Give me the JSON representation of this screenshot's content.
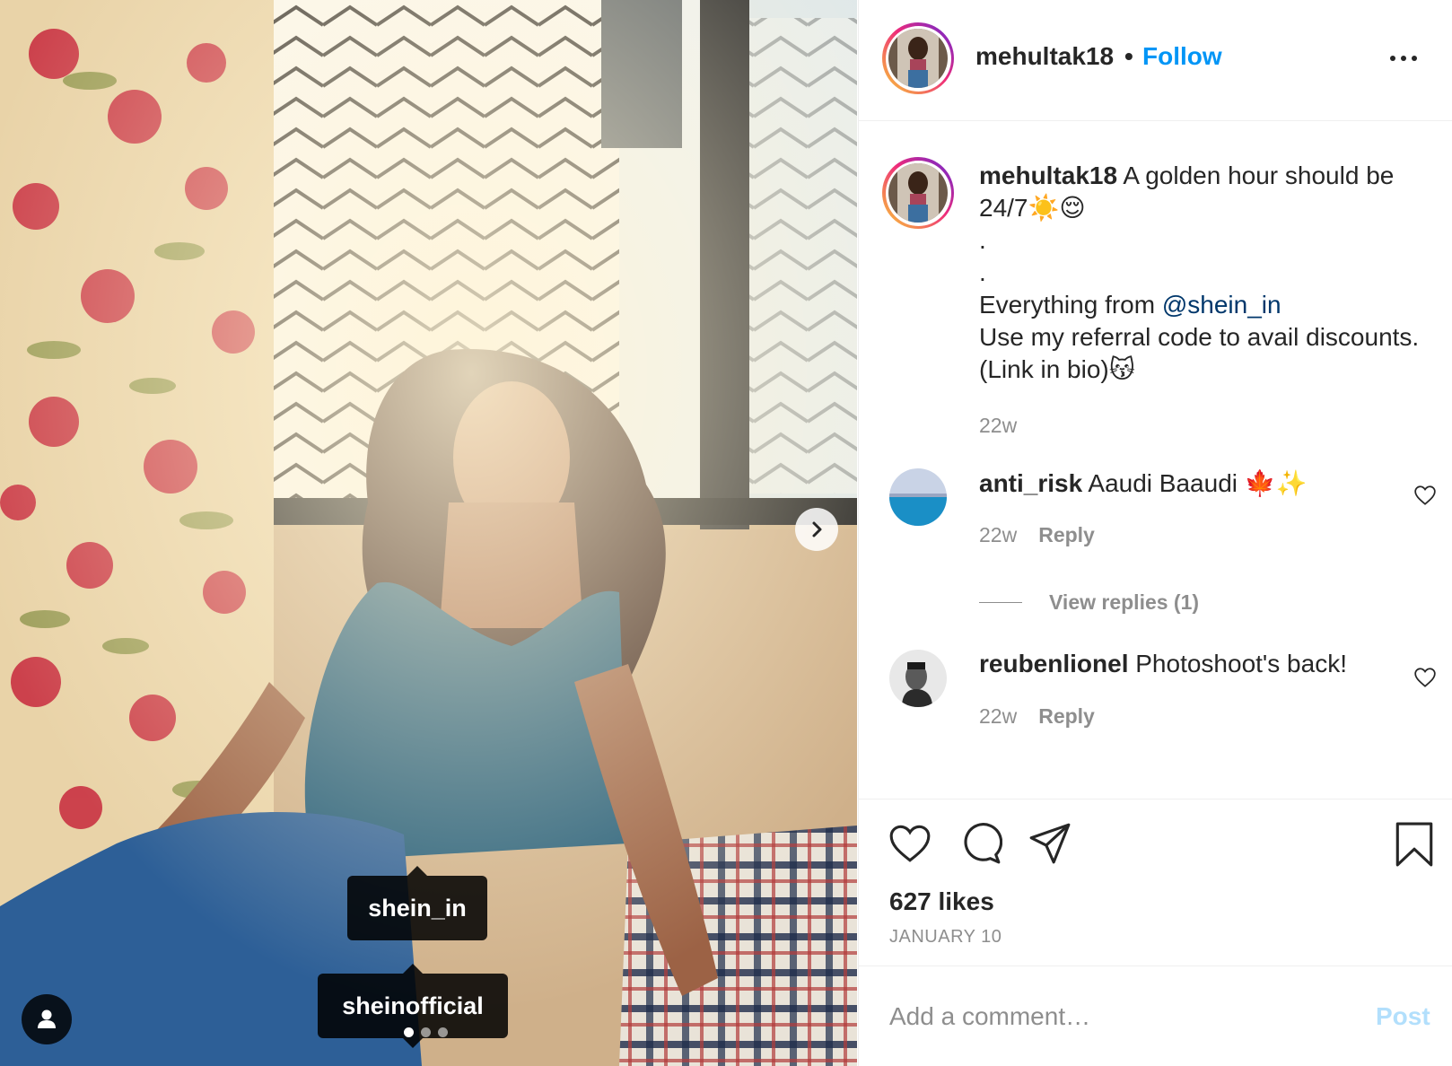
{
  "post": {
    "username": "mehultak18",
    "separator": "•",
    "follow_label": "Follow",
    "caption_lines": {
      "first": "A golden hour should be 24/7☀️😌",
      "dot1": ".",
      "dot2": ".",
      "everything_prefix": "Everything from ",
      "mention": "@shein_in",
      "referral": "Use my referral code to avail discounts.",
      "link": "(Link in bio)😽"
    },
    "caption_time": "22w"
  },
  "media": {
    "tags": [
      "shein_in",
      "sheinofficial"
    ],
    "carousel_count": 3,
    "carousel_active": 1
  },
  "comments": [
    {
      "username": "anti_risk",
      "text": "Aaudi Baaudi 🍁✨",
      "time": "22w",
      "reply_label": "Reply",
      "view_replies": "View replies (1)"
    },
    {
      "username": "reubenlionel",
      "text": "Photoshoot's back!",
      "time": "22w",
      "reply_label": "Reply"
    }
  ],
  "actions": {
    "likes": "627 likes",
    "date": "JANUARY 10"
  },
  "add_comment": {
    "placeholder": "Add a comment…",
    "post_label": "Post"
  },
  "colors": {
    "link_blue": "#0095f6",
    "mention_blue": "#00376b",
    "muted": "#8e8e8e",
    "post_disabled": "#b2dffc"
  },
  "icons": [
    "chevron-right-icon",
    "user-tag-icon",
    "more-options-icon",
    "heart-icon",
    "comment-icon",
    "share-icon",
    "bookmark-icon",
    "heart-small-icon"
  ]
}
